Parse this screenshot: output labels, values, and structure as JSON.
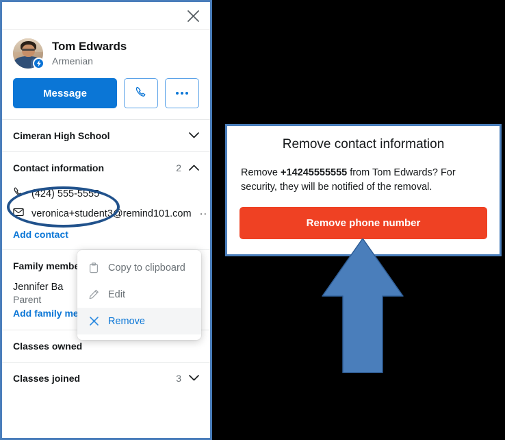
{
  "panel": {
    "close_icon": "close-icon",
    "profile": {
      "name": "Tom Edwards",
      "subtitle": "Armenian",
      "avatar_badge_icon": "lightning-badge-icon"
    },
    "actions": {
      "message_label": "Message",
      "call_icon": "phone-icon",
      "more_icon": "more-horizontal-icon"
    },
    "sections": [
      {
        "title": "Cimeran High School",
        "count": "",
        "chevron": "chevron-down-icon"
      },
      {
        "title": "Contact information",
        "count": "2",
        "chevron": "chevron-up-icon",
        "phone": "(424) 555-5555",
        "phone_icon": "phone-icon",
        "email": "veronica+student3@remind101.com",
        "email_icon": "envelope-icon",
        "email_overflow": "··",
        "add_link": "Add contact"
      },
      {
        "title": "Family members",
        "title_visible": "Family mem",
        "chevron": "chevron-down-icon",
        "member_name": "Jennifer Ba",
        "member_role": "Parent",
        "add_link": "Add family member"
      },
      {
        "title": "Classes owned",
        "count": "",
        "chevron": ""
      },
      {
        "title": "Classes joined",
        "count": "3",
        "chevron": "chevron-down-icon"
      }
    ]
  },
  "context_menu": {
    "items": [
      {
        "label": "Copy to clipboard",
        "icon": "clipboard-icon",
        "active": false
      },
      {
        "label": "Edit",
        "icon": "pencil-icon",
        "active": false
      },
      {
        "label": "Remove",
        "icon": "x-icon",
        "active": true
      }
    ]
  },
  "modal": {
    "title": "Remove contact information",
    "body_prefix": "Remove ",
    "body_phone": "+14245555555",
    "body_suffix": " from Tom Edwards? For security, they will be notified of the removal.",
    "confirm_label": "Remove phone number"
  },
  "annotations": {
    "ellipse": "phone-number-highlight-ellipse",
    "arrow": "upward-pointing-arrow"
  },
  "colors": {
    "brand_blue": "#0b76d6",
    "danger_red": "#ef4123",
    "annotation_blue": "#21528c",
    "arrow_blue": "#4a7ebb",
    "border_blue": "#4a7ebb",
    "backdrop": "#000000"
  }
}
